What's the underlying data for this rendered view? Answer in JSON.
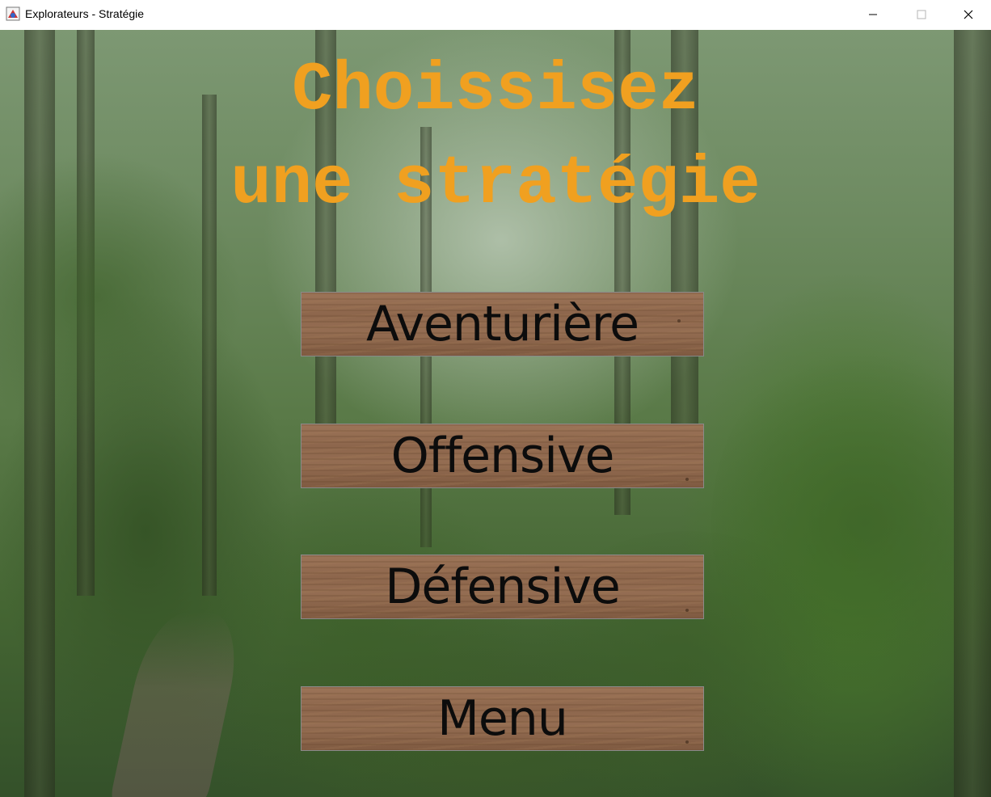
{
  "window": {
    "title": "Explorateurs - Stratégie",
    "icons": {
      "app": "java-app-icon",
      "minimize": "minimize-icon",
      "maximize": "maximize-icon",
      "close": "close-icon"
    }
  },
  "screen": {
    "heading_line1": "Choissisez",
    "heading_line2": "une stratégie",
    "heading_color": "#f0a020",
    "background": "forest-image"
  },
  "buttons": [
    {
      "label": "Aventurière"
    },
    {
      "label": "Offensive"
    },
    {
      "label": "Défensive"
    },
    {
      "label": "Menu"
    }
  ]
}
